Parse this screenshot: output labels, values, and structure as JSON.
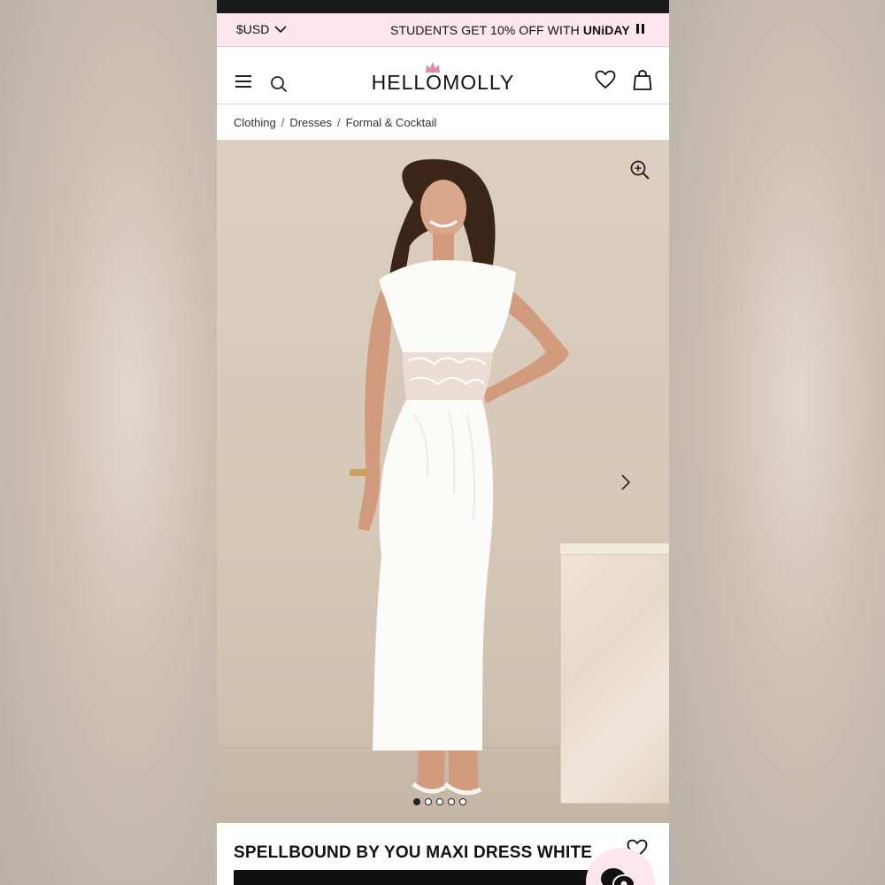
{
  "promo": {
    "currency": "$USD",
    "message_prefix": "STUDENTS GET 10% OFF WITH ",
    "message_brand": "UNiDAY"
  },
  "header": {
    "logo": "HELLOMOLLY"
  },
  "breadcrumb": {
    "items": [
      "Clothing",
      "Dresses",
      "Formal & Cocktail"
    ],
    "separator": "/"
  },
  "gallery": {
    "slide_count": 5,
    "active_slide": 1
  },
  "product": {
    "title": "SPELLBOUND BY YOU MAXI DRESS WHITE"
  },
  "icons": {
    "menu": "menu-icon",
    "search": "search-icon",
    "wishlist": "heart-icon",
    "bag": "bag-icon",
    "zoom": "zoom-in-icon",
    "next": "chevron-right-icon",
    "chat": "chat-icon"
  },
  "colors": {
    "promo_bg": "#fde6ee",
    "crown": "#d98fb0",
    "text": "#111111"
  }
}
